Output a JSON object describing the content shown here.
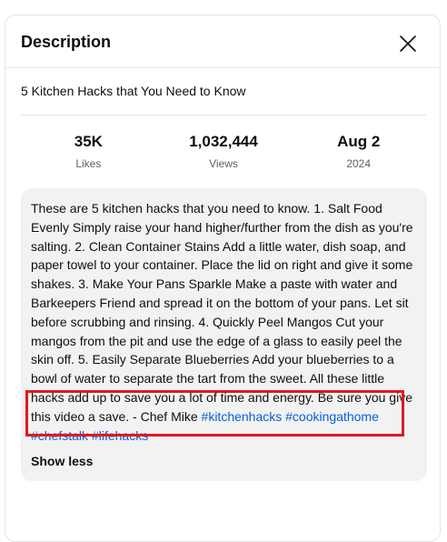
{
  "header": {
    "title": "Description"
  },
  "video": {
    "title": "5 Kitchen Hacks that You Need to Know"
  },
  "stats": [
    {
      "value": "35K",
      "label": "Likes"
    },
    {
      "value": "1,032,444",
      "label": "Views"
    },
    {
      "value": "Aug 2",
      "label": "2024"
    }
  ],
  "description": {
    "body": "These are 5 kitchen hacks that you need to know.  1. Salt Food Evenly Simply raise your hand higher/further from the dish as you're salting.  2. Clean Container Stains Add a little water, dish soap, and paper towel to your container. Place the lid on right and give it some shakes.  3. Make Your Pans Sparkle Make a paste with water and Barkeepers Friend and spread it on the bottom of your pans. Let sit before scrubbing and rinsing.  4. Quickly Peel Mangos Cut your mangos from the pit and use the edge of a glass to easily peel the skin off.  5. Easily Separate Blueberries Add your blueberries to a bowl of water to separate the tart from the sweet.  All these little hacks add up to save you a lot of time and energy. Be sure you give this video a save.  - Chef Mike ",
    "hashtags": [
      "#kitchenhacks",
      "#cookingathome",
      "#chefstalk",
      "#lifehacks"
    ],
    "show_less_label": "Show less"
  },
  "colors": {
    "hashtag": "#065fd4",
    "highlight": "#e01a22",
    "desc_background": "#f2f2f2"
  }
}
